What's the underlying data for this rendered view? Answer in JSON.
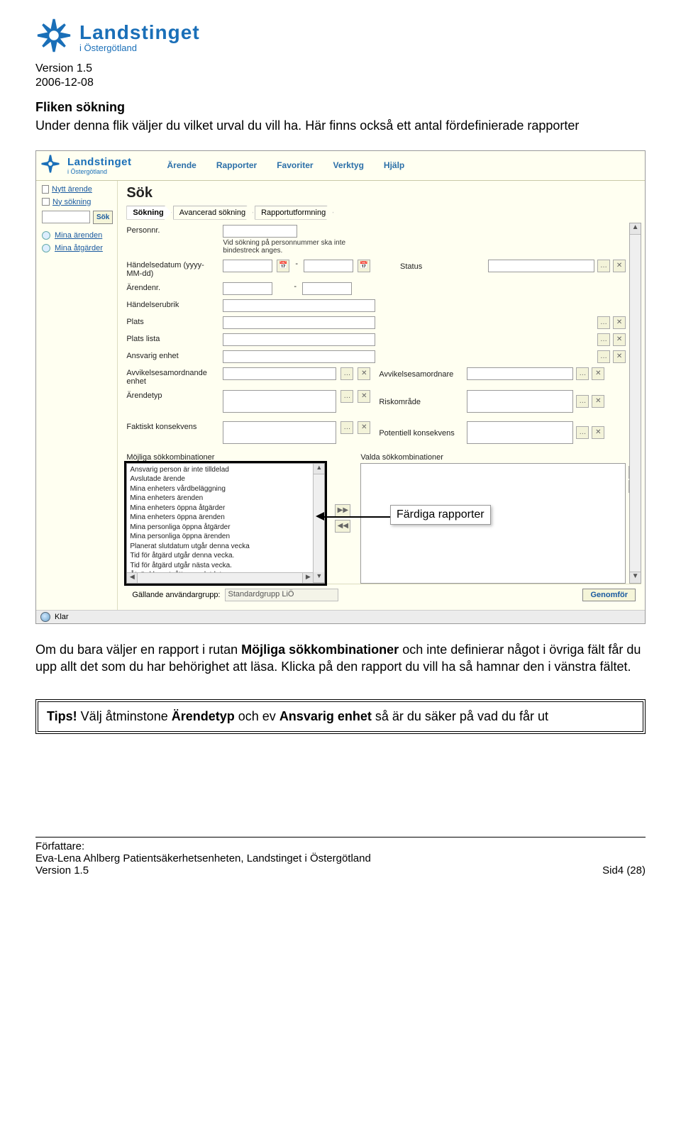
{
  "header": {
    "brand": "Landstinget",
    "brand_sub": "i Östergötland",
    "version": "Version 1.5",
    "date": "2006-12-08"
  },
  "intro": {
    "title": "Fliken sökning",
    "body": "Under denna flik väljer du vilket urval du vill ha. Här finns också ett antal fördefinierade rapporter"
  },
  "screenshot": {
    "menu": {
      "arende": "Ärende",
      "rapporter": "Rapporter",
      "favoriter": "Favoriter",
      "verktyg": "Verktyg",
      "hjalp": "Hjälp"
    },
    "side": {
      "nytt": "Nytt ärende",
      "ny_sok": "Ny sökning",
      "sok_btn": "Sök",
      "mina_arenden": "Mina ärenden",
      "mina_atgarder": "Mina åtgärder"
    },
    "main": {
      "title": "Sök",
      "tabs": {
        "sokning": "Sökning",
        "avancerad": "Avancerad sökning",
        "rapportutf": "Rapportutformning"
      },
      "fields": {
        "personnr": "Personnr.",
        "personnr_note": "Vid sökning på personnummer ska inte bindestreck anges.",
        "handelsedatum": "Händelsedatum (yyyy-MM-dd)",
        "status": "Status",
        "arendenr": "Ärendenr.",
        "handelserubrik": "Händelserubrik",
        "plats": "Plats",
        "plats_lista": "Plats lista",
        "ansvarig_enhet": "Ansvarig enhet",
        "avvikelsesamordnande_enhet": "Avvikelsesamordnande enhet",
        "avvikelsesamordnare": "Avvikelsesamordnare",
        "arendetyp": "Ärendetyp",
        "riskomrade": "Riskområde",
        "faktiskt_konsekvens": "Faktiskt konsekvens",
        "potentiell_konsekvens": "Potentiell konsekvens"
      },
      "combos": {
        "mojliga_title": "Möjliga sökkombinationer",
        "valda_title": "Valda sökkombinationer",
        "items": [
          "Ansvarig person är inte tilldelad",
          "Avslutade ärende",
          "Mina enheters vårdbeläggning",
          "Mina enheters ärenden",
          "Mina enheters öppna åtgärder",
          "Mina enheters öppna ärenden",
          "Mina personliga öppna åtgärder",
          "Mina personliga öppna ärenden",
          "Planerat slutdatum utgår denna vecka",
          "Tid för åtgärd utgår denna vecka.",
          "Tid för åtgärd utgår nästa vecka.",
          "Åtgärd har utgått pga. slutdatum"
        ]
      },
      "footer": {
        "gallande": "Gällande användargrupp:",
        "grupp": "Standardgrupp LiÖ",
        "genomfor": "Genomför"
      },
      "status": "Klar"
    }
  },
  "callout": {
    "ready": "Färdiga rapporter"
  },
  "below": {
    "p1a": "Om du bara väljer en rapport i rutan ",
    "p1b": "Möjliga sökkombinationer",
    "p1c": " och inte definierar något i övriga fält får du upp allt det som du har behörighet att läsa. Klicka på den rapport du vill ha så hamnar den i vänstra fältet."
  },
  "tips": {
    "lead": "Tips!",
    "b1": " Välj åtminstone ",
    "b2": "Ärendetyp",
    "b3": " och ev ",
    "b4": "Ansvarig enhet",
    "b5": " så är du säker på vad du får ut"
  },
  "footer": {
    "forf": "Författare:",
    "auth": "Eva-Lena Ahlberg Patientsäkerhetsenheten, Landstinget i Östergötland",
    "ver": "Version 1.5",
    "page": "Sid4 (28)"
  }
}
